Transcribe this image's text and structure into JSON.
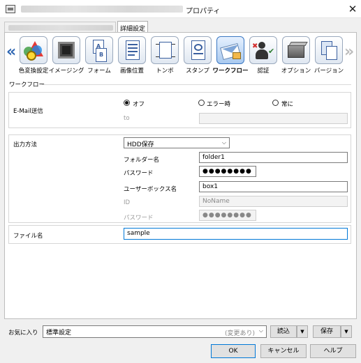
{
  "window": {
    "title_suffix": "プロパティ",
    "close_symbol": "✕"
  },
  "tabs": {
    "detail_tab": "詳細設定"
  },
  "ribbon": {
    "items": [
      {
        "label": "色変換設定",
        "icon": "color-gear-icon"
      },
      {
        "label": "イメージング",
        "icon": "imaging-icon"
      },
      {
        "label": "フォーム",
        "icon": "form-icon"
      },
      {
        "label": "画像位置",
        "icon": "image-position-icon"
      },
      {
        "label": "トンボ",
        "icon": "crop-mark-icon"
      },
      {
        "label": "スタンプ",
        "icon": "stamp-icon"
      },
      {
        "label": "ワークフロー",
        "icon": "workflow-icon",
        "active": true
      },
      {
        "label": "認証",
        "icon": "authentication-icon"
      },
      {
        "label": "オプション",
        "icon": "option-icon"
      },
      {
        "label": "バージョン",
        "icon": "version-icon"
      }
    ],
    "left_arrow": "«",
    "right_arrow": "»"
  },
  "workflow": {
    "section_title": "ワークフロー",
    "email": {
      "label": "E-Mail送信",
      "options": [
        "オフ",
        "エラー時",
        "常に"
      ],
      "selected": "オフ",
      "to_label": "to",
      "to_value": ""
    },
    "output": {
      "label": "出力方法",
      "method": "HDD保存",
      "folder_label": "フォルダー名",
      "folder_value": "folder1",
      "password_label": "パスワード",
      "password_value": "●●●●●●●●",
      "userbox_label": "ユーザーボックス名",
      "userbox_value": "box1",
      "id_label": "ID",
      "id_value": "NoName",
      "password2_label": "パスワード",
      "password2_value": "●●●●●●●●"
    },
    "file": {
      "label": "ファイル名",
      "value": "sample"
    }
  },
  "favorites": {
    "label": "お気に入り",
    "value": "標準設定",
    "status": "(変更あり)",
    "load_button": "読込",
    "save_button": "保存"
  },
  "footer": {
    "ok": "OK",
    "cancel": "キャンセル",
    "help": "ヘルプ"
  },
  "colors": {
    "accent": "#0078d7",
    "ribbon_arrow": "#2f67b3",
    "active_tool": "#3a77c2"
  }
}
